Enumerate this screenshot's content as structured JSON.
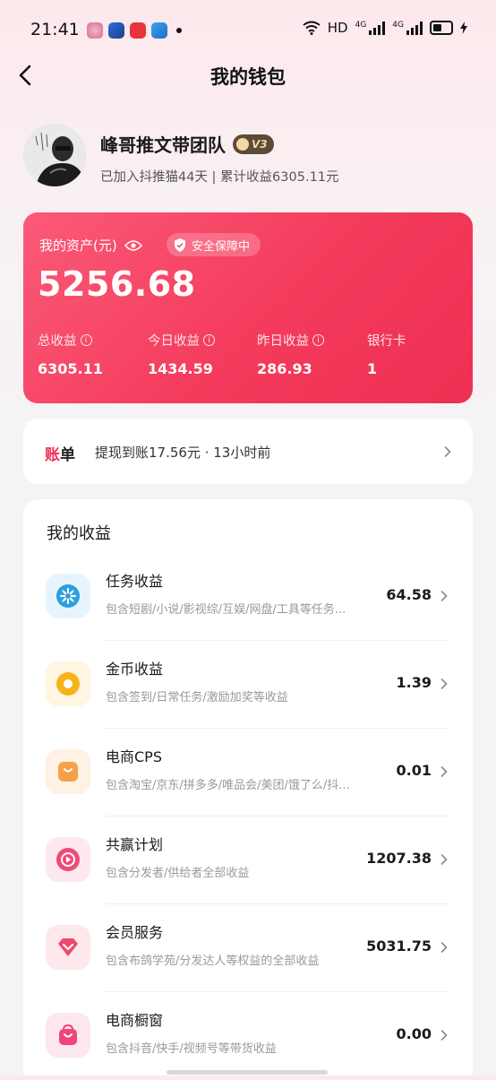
{
  "status_bar": {
    "time": "21:41",
    "network": "HD",
    "signal_labels": [
      "4G",
      "4G"
    ]
  },
  "nav": {
    "title": "我的钱包"
  },
  "profile": {
    "name": "峰哥推文带团队",
    "vip_level": "V3",
    "subtitle": "已加入抖推猫44天 | 累计收益6305.11元"
  },
  "assets": {
    "label": "我的资产(元)",
    "safe_badge": "安全保障中",
    "amount": "5256.68",
    "stats": [
      {
        "label": "总收益",
        "value": "6305.11",
        "info": true
      },
      {
        "label": "今日收益",
        "value": "1434.59",
        "info": true
      },
      {
        "label": "昨日收益",
        "value": "286.93",
        "info": true
      },
      {
        "label": "银行卡",
        "value": "1",
        "info": false
      }
    ]
  },
  "bill": {
    "badge_red": "账",
    "badge_dark": "单",
    "text": "提现到账17.56元 · 13小时前"
  },
  "earnings": {
    "title": "我的收益",
    "rows": [
      {
        "title": "任务收益",
        "desc": "包含短剧/小说/影视综/互娱/网盘/工具等任务...",
        "value": "64.58",
        "icon": "task-icon",
        "color": "#2b9fe0",
        "bg": "#e8f5fd"
      },
      {
        "title": "金币收益",
        "desc": "包含签到/日常任务/激励加奖等收益",
        "value": "1.39",
        "icon": "coin-icon",
        "color": "#f7b21f",
        "bg": "#fff6e3"
      },
      {
        "title": "电商CPS",
        "desc": "包含淘宝/京东/拼多多/唯品会/美团/饿了么/抖...",
        "value": "0.01",
        "icon": "shopping-bag-icon",
        "color": "#f7a04a",
        "bg": "#fff2e6"
      },
      {
        "title": "共赢计划",
        "desc": "包含分发者/供给者全部收益",
        "value": "1207.38",
        "icon": "play-icon",
        "color": "#ef4a78",
        "bg": "#fde9ef"
      },
      {
        "title": "会员服务",
        "desc": "包含布鸽学苑/分发达人等权益的全部收益",
        "value": "5031.75",
        "icon": "diamond-icon",
        "color": "#ef4a6a",
        "bg": "#fde9ed"
      },
      {
        "title": "电商橱窗",
        "desc": "包含抖音/快手/视频号等带货收益",
        "value": "0.00",
        "icon": "store-bag-icon",
        "color": "#f0457a",
        "bg": "#fde8ef"
      }
    ]
  }
}
